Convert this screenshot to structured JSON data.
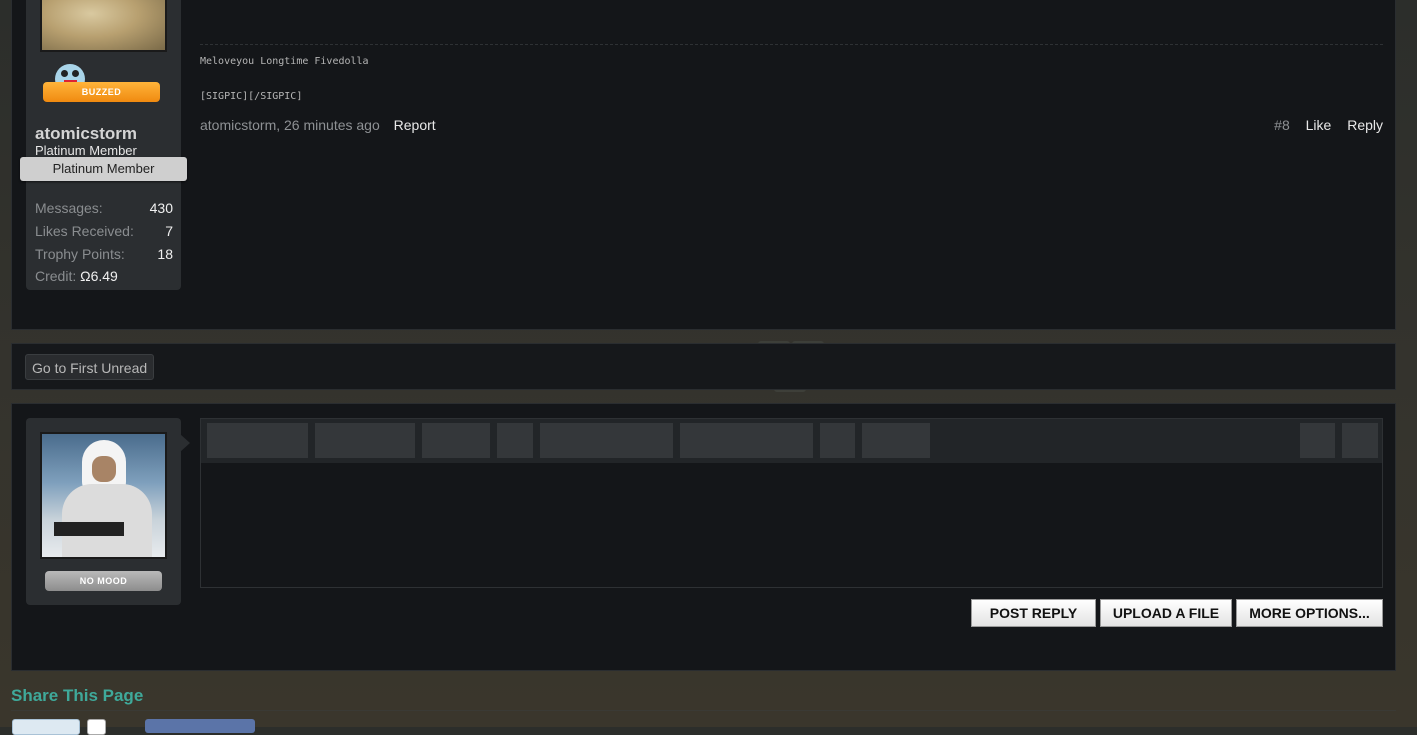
{
  "post": {
    "signature_line1": "Meloveyou Longtime Fivedolla",
    "signature_line2": "[SIGPIC][/SIGPIC]",
    "author_date": "atomicstorm, 26 minutes ago",
    "report_label": "Report",
    "permalink": "#8",
    "like_label": "Like",
    "reply_label": "Reply"
  },
  "post_user": {
    "mood_label": "BUZZED",
    "username": "atomicstorm",
    "title": "Platinum Member",
    "rank": "Platinum Member",
    "stats": [
      {
        "label": "Messages:",
        "value": "430"
      },
      {
        "label": "Likes Received:",
        "value": "7"
      },
      {
        "label": "Trophy Points:",
        "value": "18"
      }
    ],
    "credit_label": "Credit:",
    "credit_value": "Ω6.49"
  },
  "unread": {
    "label": "Go to First Unread"
  },
  "reply_user": {
    "mood_label": "NO MOOD"
  },
  "actions": {
    "post_reply": "POST REPLY",
    "upload": "UPLOAD A FILE",
    "more": "MORE OPTIONS..."
  },
  "share": {
    "title": "Share This Page"
  },
  "colors": {
    "accent": "#3fa99a",
    "panel": "#141619",
    "userblock": "#2b2e31",
    "mood_orange": "#f7941d"
  }
}
